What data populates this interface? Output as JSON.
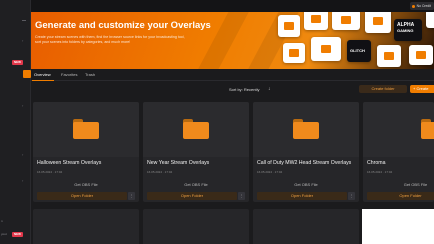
{
  "sidebar": {
    "badge_new_1": "NEW",
    "badge_new_2": "NEW",
    "bottom_labels": [
      "n",
      "yout"
    ]
  },
  "topbar": {
    "credits_label": "No Credit"
  },
  "hero": {
    "title": "Generate and customize your Overlays",
    "subtitle": "Create your stream scenes with them, find the browser source links for your broadcasting tool, sort your scenes into folders by categories, and much more!",
    "tile_texts": [
      "ALPHA",
      "GAMING",
      "GLITCH"
    ]
  },
  "tabs": [
    {
      "label": "Overview",
      "active": true
    },
    {
      "label": "Favorites",
      "active": false
    },
    {
      "label": "Trash",
      "active": false
    }
  ],
  "toolbar": {
    "sort_label": "Sort by: Recently",
    "create_folder": "Create folder",
    "create": "+ Create"
  },
  "cards": [
    {
      "title": "Halloween Stream Overlays",
      "meta": "16.05.2024 · 17:04",
      "get_label": "Get OBS File",
      "open_label": "Open Folder",
      "more": "⋮"
    },
    {
      "title": "New Year Stream Overlays",
      "meta": "16.05.2024 · 17:04",
      "get_label": "Get OBS File",
      "open_label": "Open Folder",
      "more": "⋮"
    },
    {
      "title": "Call of Duty MW2 Head Stream Overlays",
      "meta": "16.05.2024 · 17:04",
      "get_label": "Get OBS File",
      "open_label": "Open Folder",
      "more": "⋮"
    },
    {
      "title": "Chroma",
      "meta": "16.05.2024 · 17:04",
      "get_label": "Get OBS File",
      "open_label": "Open Folder",
      "more": "⋮"
    }
  ],
  "colors": {
    "accent": "#f07d00",
    "background": "#1b1b1d",
    "card": "#262629",
    "badge": "#e2374a"
  }
}
